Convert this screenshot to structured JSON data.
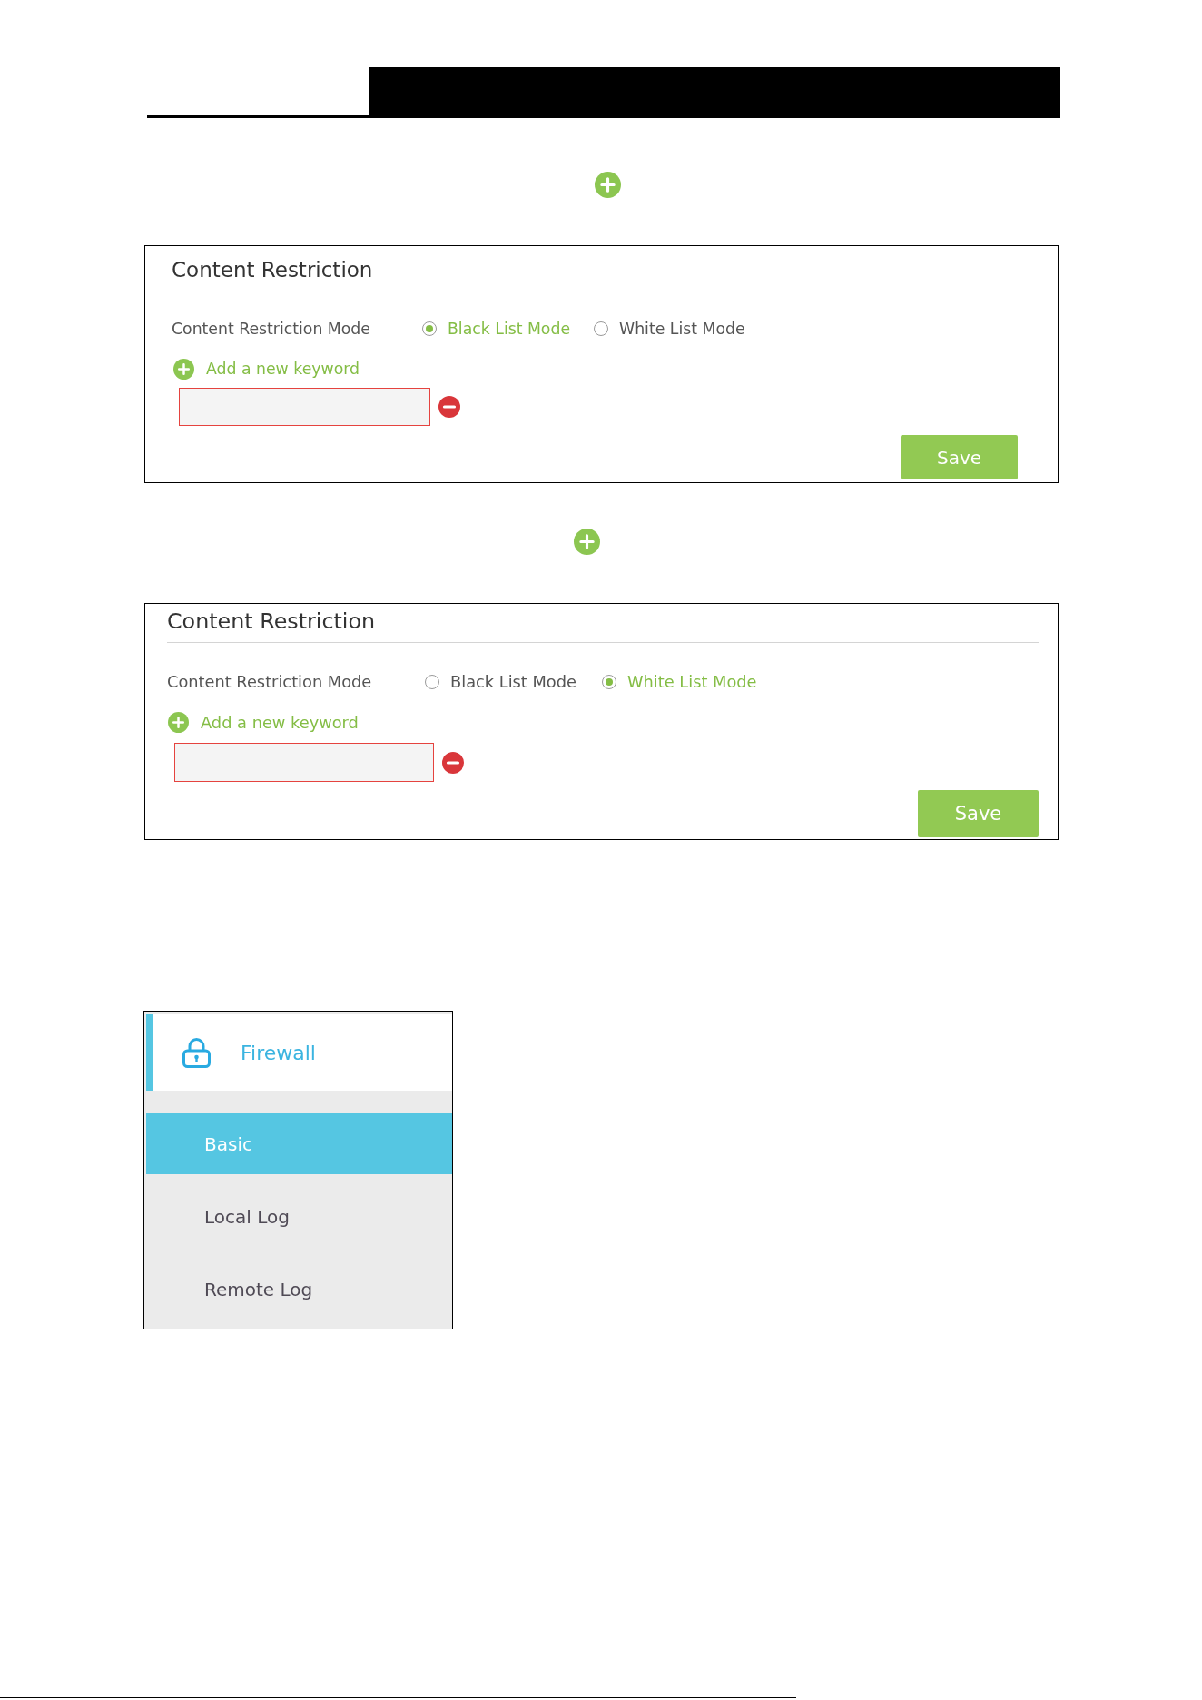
{
  "panels": [
    {
      "title": "Content Restriction",
      "mode_label": "Content Restriction Mode",
      "modes": [
        {
          "label": "Black List Mode",
          "selected": true
        },
        {
          "label": "White List Mode",
          "selected": false
        }
      ],
      "add_keyword": "Add a new keyword",
      "keywords": [
        {
          "error": true
        }
      ],
      "save_button": "Save"
    },
    {
      "title": "Content Restriction",
      "mode_label": "Content Restriction Mode",
      "modes": [
        {
          "label": "Black List Mode",
          "selected": false
        },
        {
          "label": "White List Mode",
          "selected": true
        }
      ],
      "add_keyword": "Add a new keyword",
      "keywords": [
        {
          "error": true
        }
      ],
      "save_button": "Save"
    }
  ],
  "sidebar": {
    "section": {
      "label": "Firewall",
      "active": true
    },
    "items": [
      {
        "label": "Basic",
        "selected": true
      },
      {
        "label": "Local Log",
        "selected": false
      },
      {
        "label": "Remote Log",
        "selected": false
      }
    ]
  }
}
